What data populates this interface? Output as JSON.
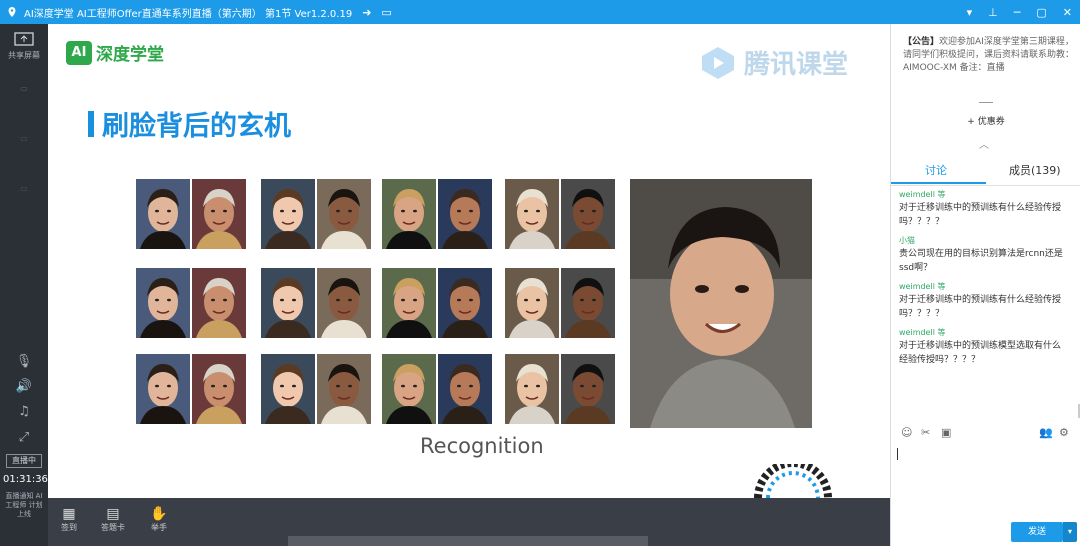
{
  "titlebar": {
    "title": "AI深度学堂  AI工程师Offer直通车系列直播（第六期）  第1节  Ver1.2.0.19",
    "share_icon": "share-arrow-icon",
    "folder_icon": "folder-icon",
    "win_icons": [
      "chevron-down-icon",
      "pin-icon",
      "minimize-icon",
      "maximize-icon",
      "close-icon"
    ]
  },
  "leftbar": {
    "items": [
      {
        "icon": "screen-share-icon",
        "label": "共享屏幕"
      },
      {
        "icon": "microphone-icon",
        "label": ""
      },
      {
        "icon": "speaker-icon",
        "label": ""
      },
      {
        "icon": "music-icon",
        "label": ""
      },
      {
        "icon": "fullscreen-icon",
        "label": ""
      }
    ],
    "badge": "直播中",
    "time": "01:31:36",
    "footer": "直播通知 AI工程师 计划上线"
  },
  "slide": {
    "logo_left_ai": "AI",
    "logo_left_text": "深度学堂",
    "logo_right_text": "腾讯课堂",
    "title": "刷脸背后的玄机",
    "caption": "Recognition"
  },
  "bottombar": {
    "items": [
      {
        "icon": "sign-in-icon",
        "label": "签到"
      },
      {
        "icon": "answer-card-icon",
        "label": "答题卡"
      },
      {
        "icon": "hand-raise-icon",
        "label": "举手"
      }
    ]
  },
  "right": {
    "notice_label": "【公告】",
    "notice_text": "欢迎参加AI深度学堂第三期课程，请同学们积极提问，课后资料请联系助教：AIMOOC-XM 备注：直播",
    "coupon": "+ 优惠券",
    "collapse_icon": "chevron-up-icon",
    "tab_discuss": "讨论",
    "tab_members": "成员(139)",
    "messages": [
      {
        "user": "weimdell 等",
        "text": "对于迁移训练中的预训练有什么经验传授吗？？？？"
      },
      {
        "user": "小猫",
        "text": "贵公司现在用的目标识别算法是rcnn还是ssd啊？"
      },
      {
        "user": "weimdell 等",
        "text": "对于迁移训练中的预训练有什么经验传授吗？？？？"
      },
      {
        "user": "weimdell 等",
        "text": "对于迁移训练中的预训练模型选取有什么经验传授吗？？？？"
      }
    ],
    "tools": [
      "emoji-icon",
      "scissors-icon",
      "image-icon",
      "users-icon",
      "settings-icon"
    ],
    "send": "发送",
    "send_dropdown": "▾"
  }
}
